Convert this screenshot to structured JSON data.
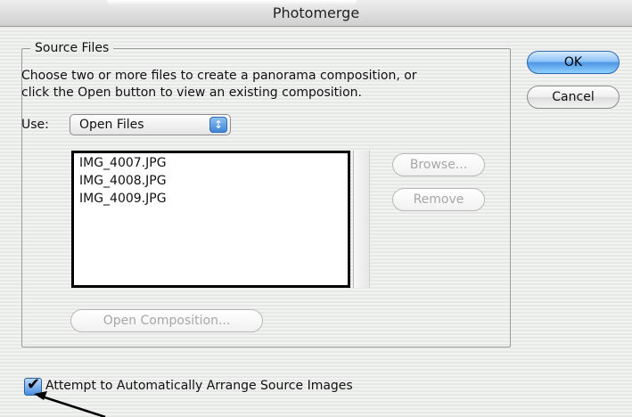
{
  "window": {
    "title": "Photomerge"
  },
  "source_files": {
    "legend": "Source Files",
    "description_line1": "Choose two or more files to create a panorama composition, or",
    "description_line2": "click the Open button to view an existing composition.",
    "use_label": "Use:",
    "use_value": "Open Files",
    "files": [
      "IMG_4007.JPG",
      "IMG_4008.JPG",
      "IMG_4009.JPG"
    ],
    "browse_label": "Browse...",
    "remove_label": "Remove",
    "open_composition_label": "Open Composition..."
  },
  "buttons": {
    "ok_label": "OK",
    "cancel_label": "Cancel"
  },
  "auto_arrange": {
    "label": "Attempt to Automatically Arrange Source Images",
    "checked": true
  }
}
